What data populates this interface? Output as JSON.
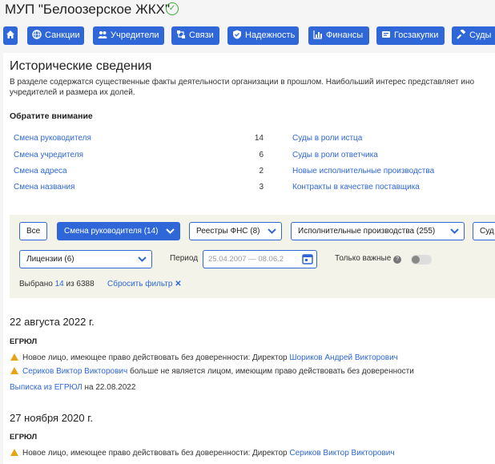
{
  "header": {
    "title": "МУП \"Белоозерское ЖКХ\"",
    "nav": [
      {
        "label": "",
        "icon": "home-icon"
      },
      {
        "label": "Санкции",
        "icon": "globe-icon"
      },
      {
        "label": "Учредители",
        "icon": "users-icon"
      },
      {
        "label": "Связи",
        "icon": "links-icon"
      },
      {
        "label": "Надежность",
        "icon": "shield-icon"
      },
      {
        "label": "Финансы",
        "icon": "chart-icon"
      },
      {
        "label": "Госзакупки",
        "icon": "contract-icon"
      },
      {
        "label": "Суды",
        "icon": "gavel-icon"
      }
    ]
  },
  "main": {
    "heading": "Исторические сведения",
    "description_line1": "В разделе содержатся существенные факты деятельности организации в прошлом. Наибольший интерес представляет ино",
    "description_line2": "учредителей и размера их долей.",
    "attention": "Обратите внимание",
    "left_links": [
      {
        "label": "Смена руководителя",
        "count": "14"
      },
      {
        "label": "Смена учредителя",
        "count": "6"
      },
      {
        "label": "Смена адреса",
        "count": "2"
      },
      {
        "label": "Смена названия",
        "count": "3"
      }
    ],
    "right_links": [
      "Суды в роли истца",
      "Суды в роли ответчика",
      "Новые исполнительные производства",
      "Контракты в качестве поставщика"
    ]
  },
  "filters": {
    "all": "Все",
    "director_change": "Смена руководителя (14)",
    "fns": "Реестры ФНС (8)",
    "enforcement": "Исполнительные производства (255)",
    "courts": "Суд",
    "licenses": "Лицензии (6)",
    "period_label": "Период",
    "period_value": "25.04.2007 — 08.06.2",
    "only_important": "Только важные",
    "selected_prefix": "Выбрано",
    "selected_count": "14",
    "selected_of": "из 6388",
    "reset": "Сбросить фильтр"
  },
  "events": [
    {
      "date": "22 августа 2022 г.",
      "source": "ЕГРЮЛ",
      "line1_text": "Новое лицо, имеющее право действовать без доверенности: Директор ",
      "line1_link": "Шориков Андрей Викторович",
      "line2_link": "Сериков Виктор Викторович",
      "line2_text": " больше не является лицом, имеющим право действовать без доверенности",
      "extract_link": "Выписка из ЕГРЮЛ",
      "extract_date": " на 22.08.2022"
    },
    {
      "date": "27 ноября 2020 г.",
      "source": "ЕГРЮЛ",
      "line1_text": "Новое лицо, имеющее право действовать без доверенности: Директор ",
      "line1_link": "Сериков Виктор Викторович"
    }
  ],
  "colors": {
    "accent": "#2f67d9",
    "warning": "#e8a317",
    "ok": "#3aaa35"
  }
}
